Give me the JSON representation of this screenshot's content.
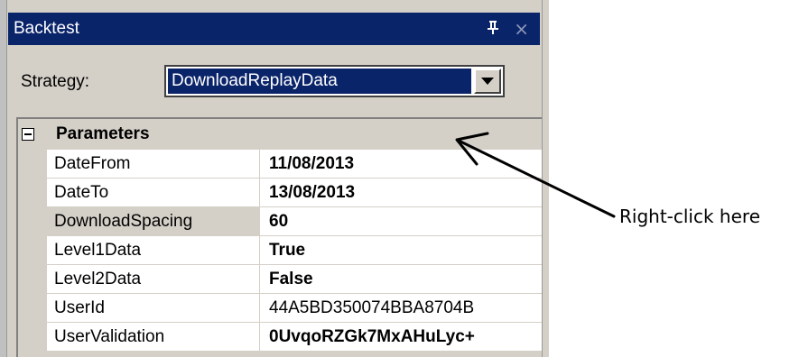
{
  "window": {
    "title": "Backtest",
    "pin_glyph": "٩",
    "close_glyph": "×"
  },
  "strategy": {
    "label": "Strategy:",
    "selected": "DownloadReplayData"
  },
  "property_grid": {
    "category": "Parameters",
    "rows": [
      {
        "name": "DateFrom",
        "value": "11/08/2013"
      },
      {
        "name": "DateTo",
        "value": "13/08/2013"
      },
      {
        "name": "DownloadSpacing",
        "value": "60"
      },
      {
        "name": "Level1Data",
        "value": "True"
      },
      {
        "name": "Level2Data",
        "value": "False"
      },
      {
        "name": "UserId",
        "value": "44A5BD350074BBA8704B"
      },
      {
        "name": "UserValidation",
        "value": "0UvqoRZGk7MxAHuLyc+"
      }
    ]
  },
  "annotation": {
    "text": "Right-click here"
  },
  "colors": {
    "titlebar": "#0a246a",
    "panel": "#d4d0c8",
    "selection": "#0a246a"
  }
}
